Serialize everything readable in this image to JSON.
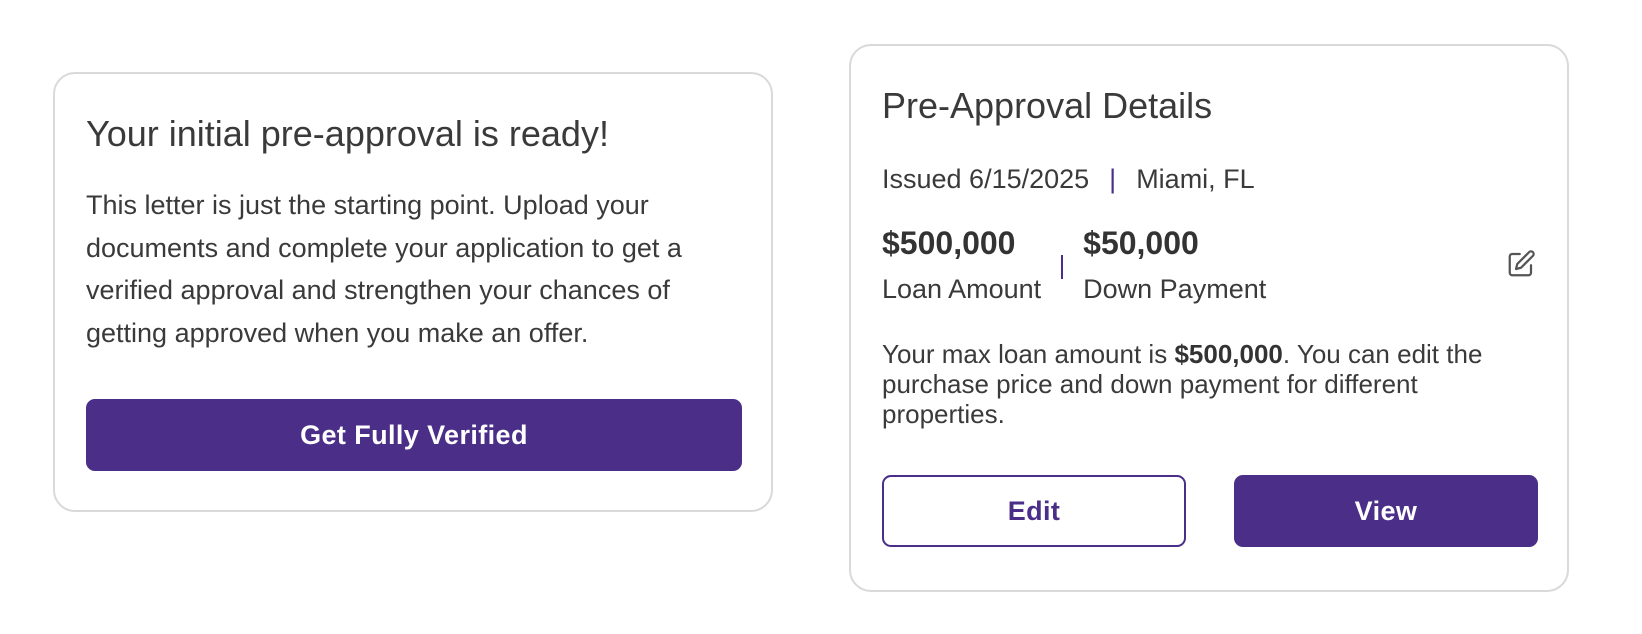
{
  "left_card": {
    "title": "Your initial pre-approval is ready!",
    "body": "This letter is just the starting point. Upload your documents and complete your application to get a verified approval and strengthen your chances of getting approved when you make an offer.",
    "button_label": "Get Fully Verified"
  },
  "right_card": {
    "title": "Pre-Approval Details",
    "issued": "Issued 6/15/2025",
    "separator": "|",
    "location": "Miami, FL",
    "loan_amount_value": "$500,000",
    "loan_amount_label": "Loan Amount",
    "down_payment_value": "$50,000",
    "down_payment_label": "Down Payment",
    "edit_icon": "pencil-square-icon",
    "max_text_prefix": "Your max loan amount is ",
    "max_text_amount": "$500,000",
    "max_text_suffix": ". You can edit the purchase price and down payment for different properties.",
    "edit_button_label": "Edit",
    "view_button_label": "View"
  },
  "colors": {
    "brand_purple": "#4b2e87",
    "card_border": "#d9d9d9",
    "text": "#3a3a3a"
  }
}
